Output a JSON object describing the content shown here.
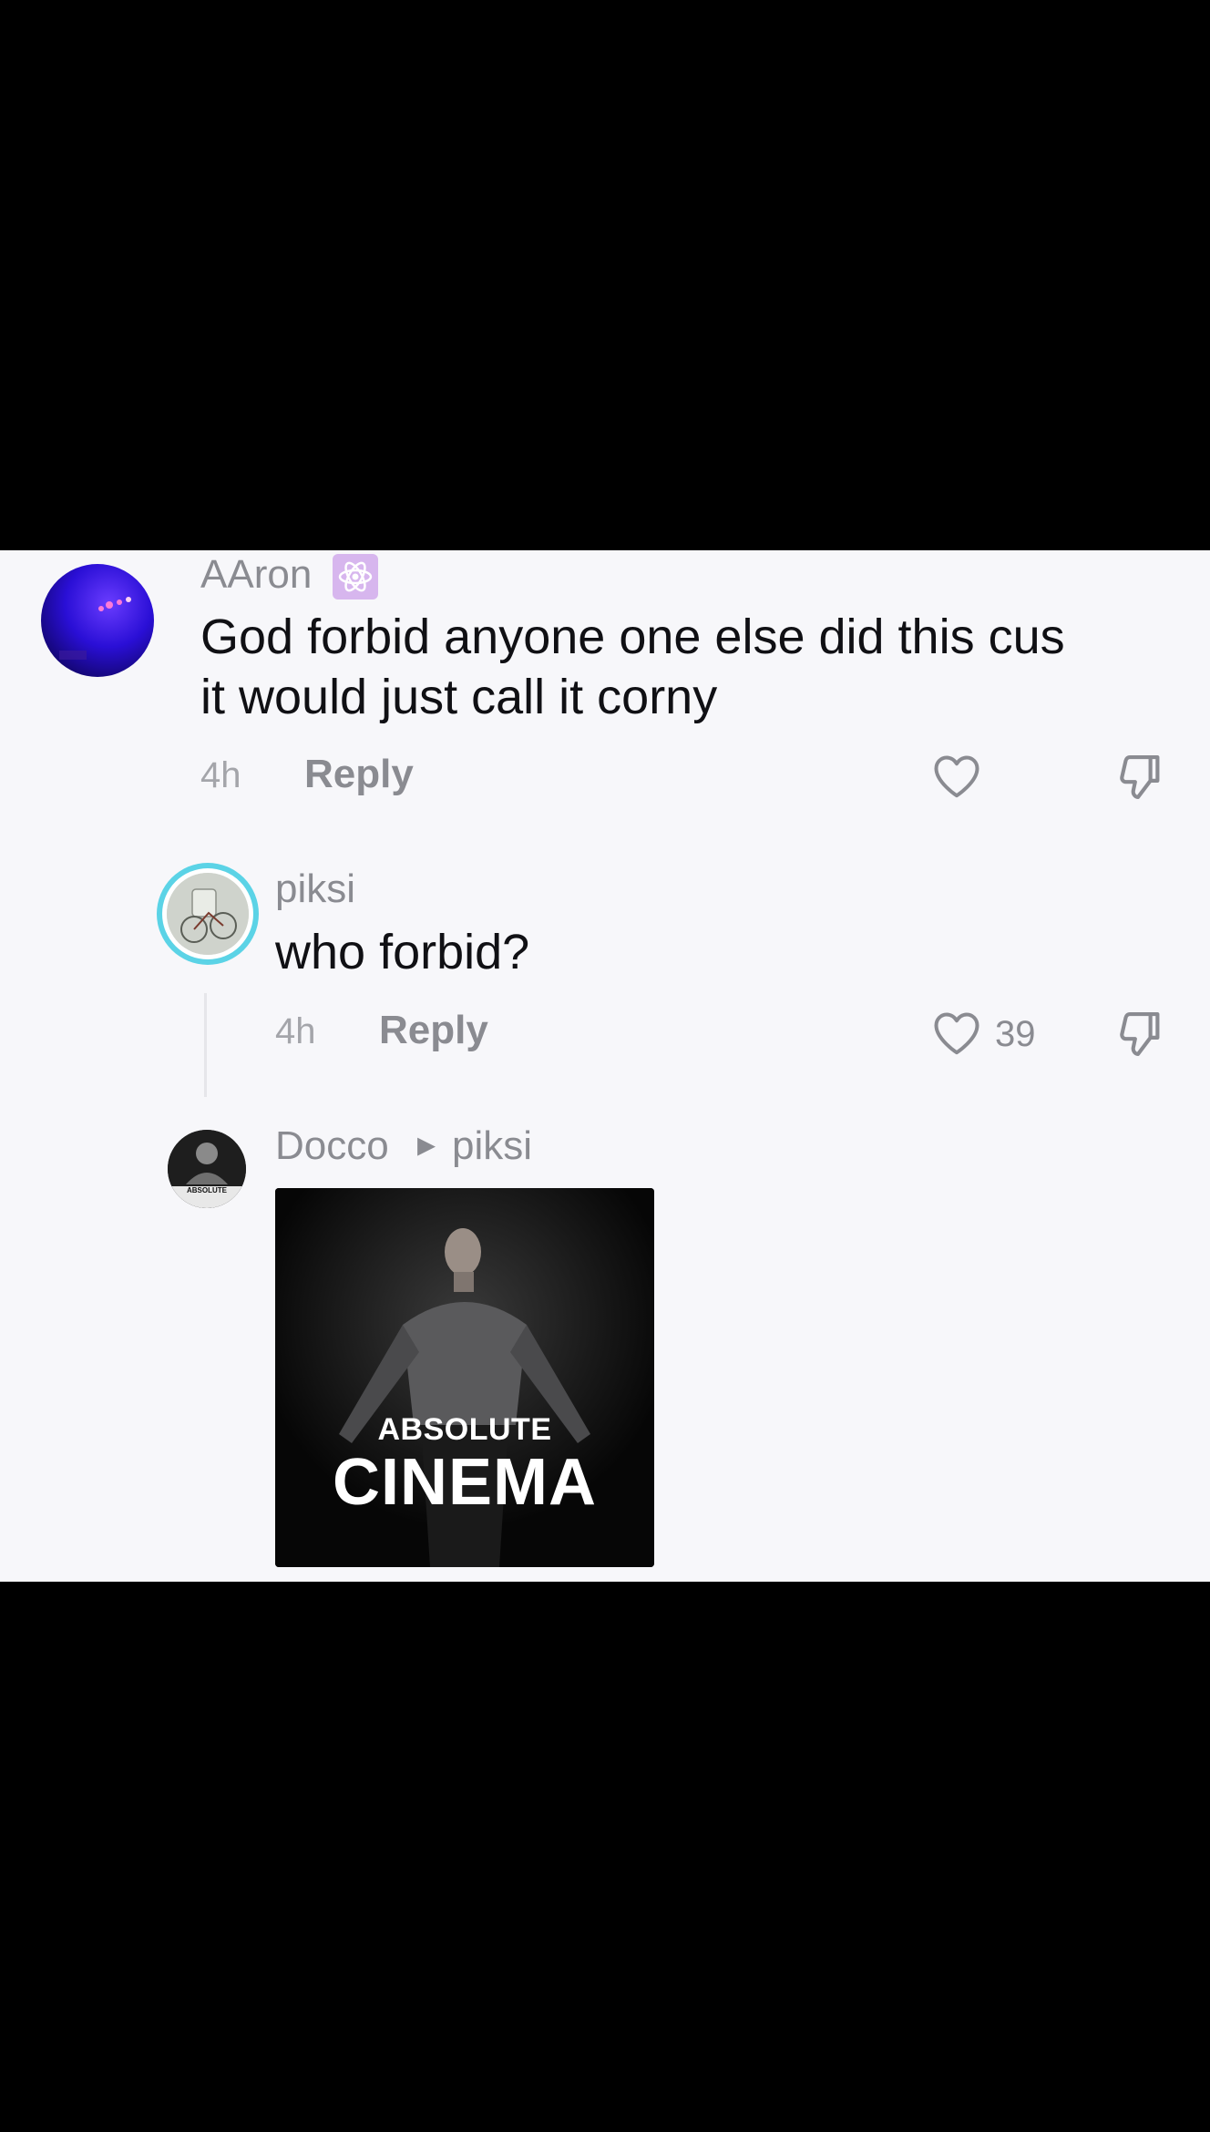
{
  "comments": [
    {
      "username": "AAron",
      "badge_icon": "atom-icon",
      "text_line1": "God forbid anyone one else did this cus",
      "text_line2": "it would just call it corny",
      "time": "4h",
      "reply_label": "Reply",
      "like_icon": "heart-outline-icon",
      "dislike_icon": "thumbs-down-icon"
    },
    {
      "username": "piksi",
      "text": "who forbid?",
      "time": "4h",
      "reply_label": "Reply",
      "like_count": "39",
      "like_icon": "heart-outline-icon",
      "dislike_icon": "thumbs-down-icon"
    },
    {
      "username": "Docco",
      "reply_to_arrow": "▸",
      "reply_to": "piksi",
      "avatar_text": "ABSOLUTE",
      "sticker_top": "ABSOLUTE",
      "sticker_main": "CINEMA"
    }
  ],
  "colors": {
    "panel_bg": "#f7f7fa",
    "letterbox": "#000000",
    "avatar_ring": "#5bd3e6"
  }
}
